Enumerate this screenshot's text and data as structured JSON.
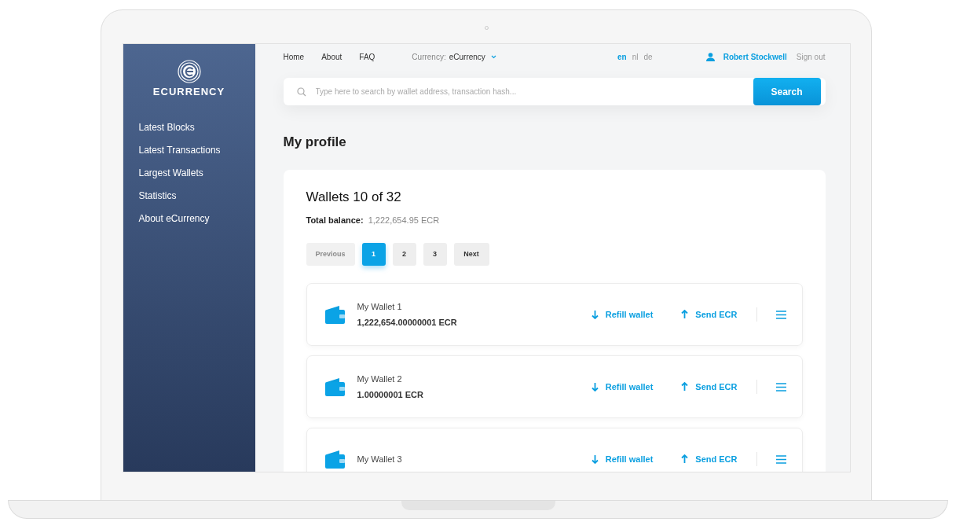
{
  "logo": {
    "text": "ECURRENCY"
  },
  "sidebar": {
    "items": [
      {
        "label": "Latest Blocks"
      },
      {
        "label": "Latest Transactions"
      },
      {
        "label": "Largest Wallets"
      },
      {
        "label": "Statistics"
      },
      {
        "label": "About eCurrency"
      }
    ]
  },
  "nav": {
    "links": [
      "Home",
      "About",
      "FAQ"
    ],
    "currency_label": "Currency:",
    "currency_value": "eCurrency",
    "languages": [
      {
        "label": "en",
        "selected": true
      },
      {
        "label": "nl",
        "selected": false
      },
      {
        "label": "de",
        "selected": false
      }
    ],
    "user_name": "Robert Stockwell",
    "sign_out": "Sign out"
  },
  "search": {
    "placeholder": "Type here to search by wallet address, transaction hash...",
    "button": "Search"
  },
  "page_title": "My profile",
  "wallets_card": {
    "title": "Wallets 10 of 32",
    "total_label": "Total balance:",
    "total_value": "1,222,654.95 ECR",
    "pagination": [
      {
        "label": "Previous",
        "kind": "nav",
        "disabled": true,
        "selected": false
      },
      {
        "label": "1",
        "kind": "page",
        "disabled": false,
        "selected": true
      },
      {
        "label": "2",
        "kind": "page",
        "disabled": false,
        "selected": false
      },
      {
        "label": "3",
        "kind": "page",
        "disabled": false,
        "selected": false
      },
      {
        "label": "Next",
        "kind": "nav",
        "disabled": false,
        "selected": false
      }
    ],
    "wallets": [
      {
        "name": "My Wallet 1",
        "balance": "1,222,654.00000001 ECR",
        "refill": "Refill wallet",
        "send": "Send ECR"
      },
      {
        "name": "My Wallet 2",
        "balance": "1.00000001 ECR",
        "refill": "Refill wallet",
        "send": "Send ECR"
      },
      {
        "name": "My Wallet 3",
        "refill": "Refill wallet",
        "send": "Send ECR"
      }
    ]
  }
}
